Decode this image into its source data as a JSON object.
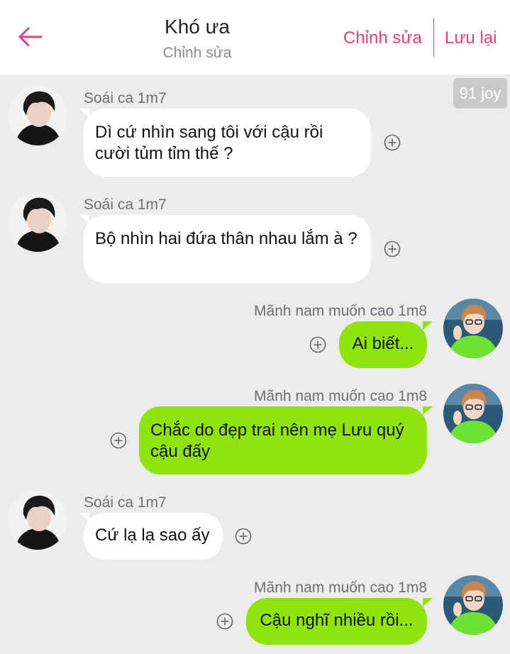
{
  "header": {
    "back_icon": "arrow-left-icon",
    "title": "Khó ưa",
    "subtitle": "Chỉnh sửa",
    "edit_label": "Chỉnh sửa",
    "save_label": "Lưu lại",
    "accent_color": "#e0407e"
  },
  "watermark": "91 joy",
  "colors": {
    "background": "#ececec",
    "left_bubble": "#ffffff",
    "right_bubble": "#8ee40c"
  },
  "messages": [
    {
      "sender": "Soái ca 1m7",
      "side": "left",
      "text": "Dì cứ nhìn sang tôi với cậu rồi cười tủm tỉm thế ?"
    },
    {
      "sender": "Soái ca 1m7",
      "side": "left",
      "text": "Bộ nhìn hai đứa thân nhau lắm à ?"
    },
    {
      "sender": "Mãnh nam muốn cao 1m8",
      "side": "right",
      "text": "Ai biết..."
    },
    {
      "sender": "Mãnh nam muốn cao 1m8",
      "side": "right",
      "text": "Chắc do đẹp trai nên mẹ Lưu quý cậu đấy"
    },
    {
      "sender": "Soái ca 1m7",
      "side": "left",
      "text": "Cứ lạ lạ sao ấy"
    },
    {
      "sender": "Mãnh nam muốn cao 1m8",
      "side": "right",
      "text": "Cậu nghĩ nhiều rồi..."
    }
  ]
}
